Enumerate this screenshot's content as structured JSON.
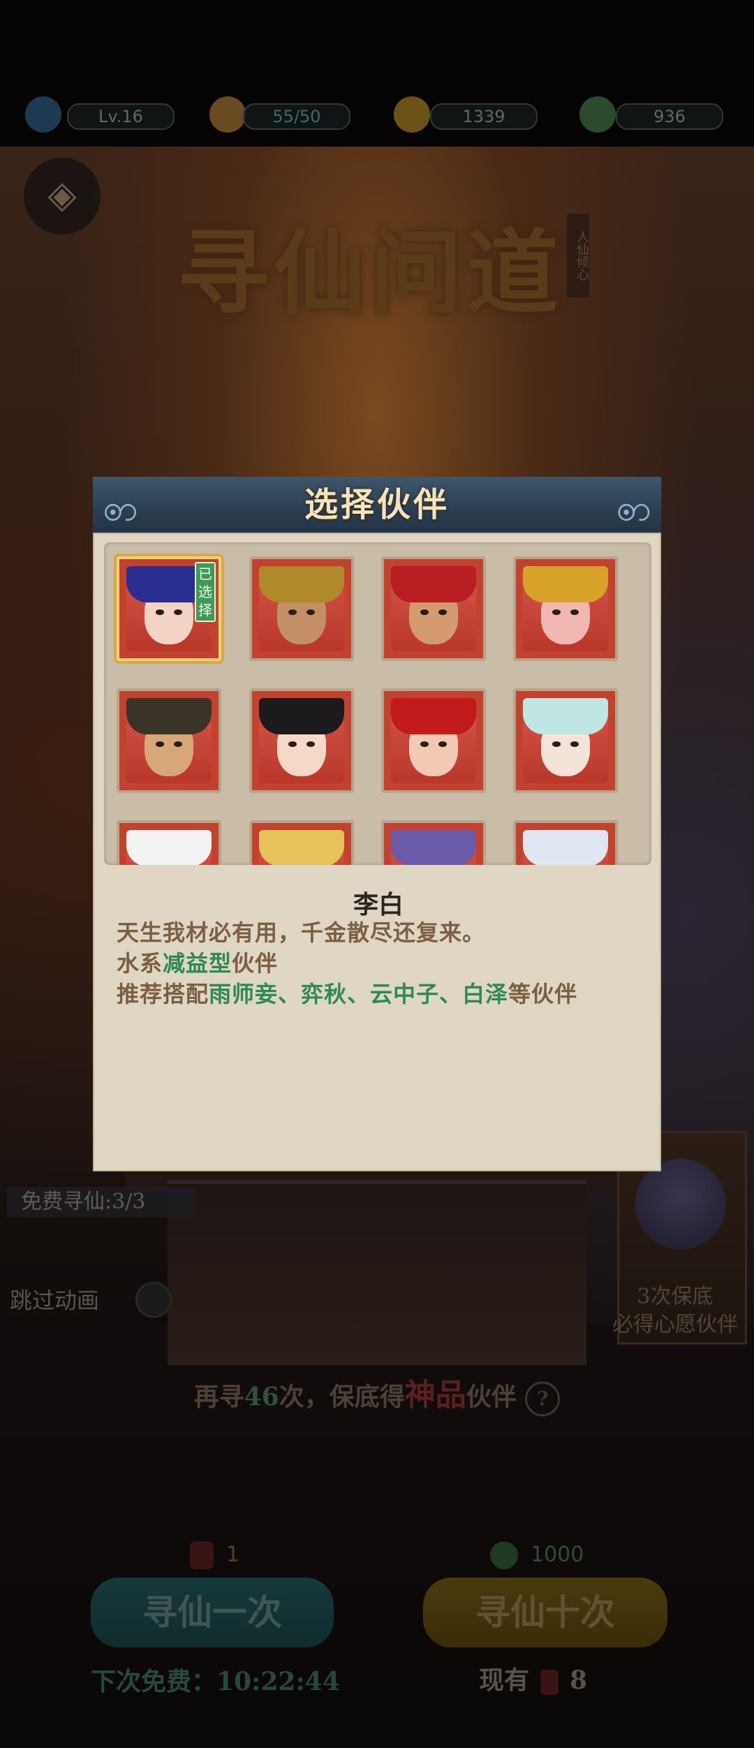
{
  "resources": {
    "level": "Lv.16",
    "stamina": "55/50",
    "coins": "1339",
    "jade": "936"
  },
  "title_art": "寻仙问道",
  "title_seal": "人仙倾心",
  "free_search": "免费寻仙:3/3",
  "skip_animation": "跳过动画",
  "reward": {
    "tag": "心愿伙伴",
    "line1": "3次保底",
    "line2": "必得心愿伙伴"
  },
  "guarantee": {
    "prefix": "再寻",
    "count": "46",
    "middle": "次，保底得",
    "rarity": "神品",
    "suffix": "伙伴",
    "help": "?"
  },
  "single": {
    "cost": "1",
    "label": "寻仙一次",
    "next_free": "下次免费：10:22:44"
  },
  "ten": {
    "cost": "1000",
    "label": "寻仙十次",
    "owned_label": "现有",
    "owned_value": "8"
  },
  "modal": {
    "title": "选择伙伴",
    "selected_badge": "已选择",
    "partners": [
      {
        "hair": "#2a2f8f",
        "skin": "#f3d3c4",
        "selected": true
      },
      {
        "hair": "#b08a2a",
        "skin": "#c48f64"
      },
      {
        "hair": "#b81f22",
        "skin": "#d69a70"
      },
      {
        "hair": "#d9a32a",
        "skin": "#f2b7b0"
      },
      {
        "hair": "#3a3428",
        "skin": "#d7a679"
      },
      {
        "hair": "#1d1a1e",
        "skin": "#f5d8c8"
      },
      {
        "hair": "#c01a1a",
        "skin": "#f1c9b4"
      },
      {
        "hair": "#bfe6e2",
        "skin": "#f5e3da"
      },
      {
        "hair": "#f2f2f2",
        "skin": "#f0d9c8"
      },
      {
        "hair": "#e7c25a",
        "skin": "#f0d0b0"
      },
      {
        "hair": "#6a5aa8",
        "skin": "#e6d0e0"
      },
      {
        "hair": "#dfe6f2",
        "skin": "#eee2dc"
      }
    ],
    "hero": {
      "name": "李白",
      "quote": "天生我材必有用，千金散尽还复来。",
      "type_prefix": "水系",
      "type_highlight": "减益型",
      "type_suffix": "伙伴",
      "recommend_prefix": "推荐搭配",
      "recommend_highlight": "雨师妾、弈秋、云中子、白泽",
      "recommend_suffix": "等伙伴"
    }
  }
}
